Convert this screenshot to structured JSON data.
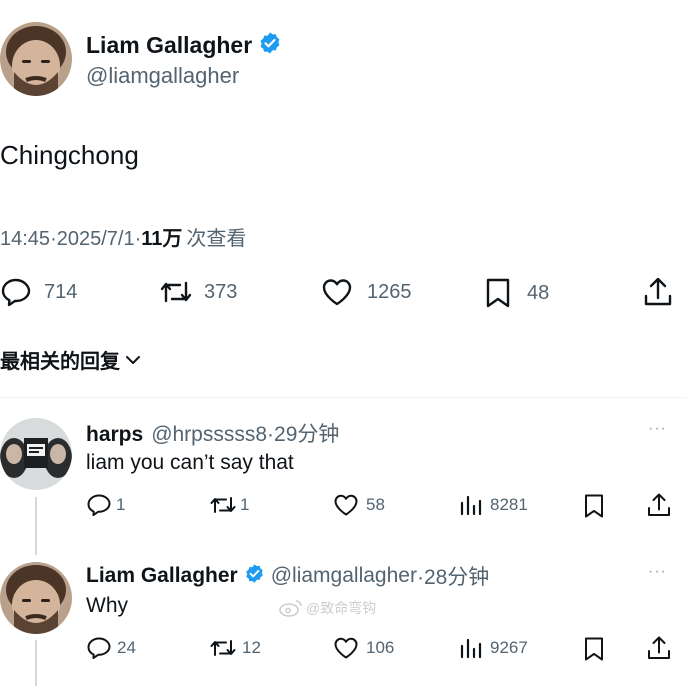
{
  "main_tweet": {
    "author_name": "Liam Gallagher",
    "author_handle": "@liamgallagher",
    "text": "Chingchong",
    "time": "14:45",
    "dot1": "·",
    "date": "2025/7/1",
    "dot2": "·",
    "views_count": "11万",
    "views_label": "次查看",
    "replies": "714",
    "retweets": "373",
    "likes": "1265",
    "bookmarks": "48"
  },
  "replies_sort_label": "最相关的回复",
  "replies": [
    {
      "author_name": "harps",
      "author_handle": "@hrpsssss8",
      "time_ago": "·29分钟",
      "text": "liam you can’t say that",
      "replies": "1",
      "retweets": "1",
      "likes": "58",
      "views": "8281",
      "more": "···"
    },
    {
      "author_name": "Liam Gallagher",
      "author_handle": "@liamgallagher",
      "time_ago": "·28分钟",
      "text": "Why",
      "replies": "24",
      "retweets": "12",
      "likes": "106",
      "views": "9267",
      "more": "···"
    }
  ],
  "watermark": "@致命弯钩",
  "colors": {
    "text": "#0f1419",
    "secondary": "#536471",
    "verified": "#1d9bf0",
    "divider": "#eff3f4"
  }
}
